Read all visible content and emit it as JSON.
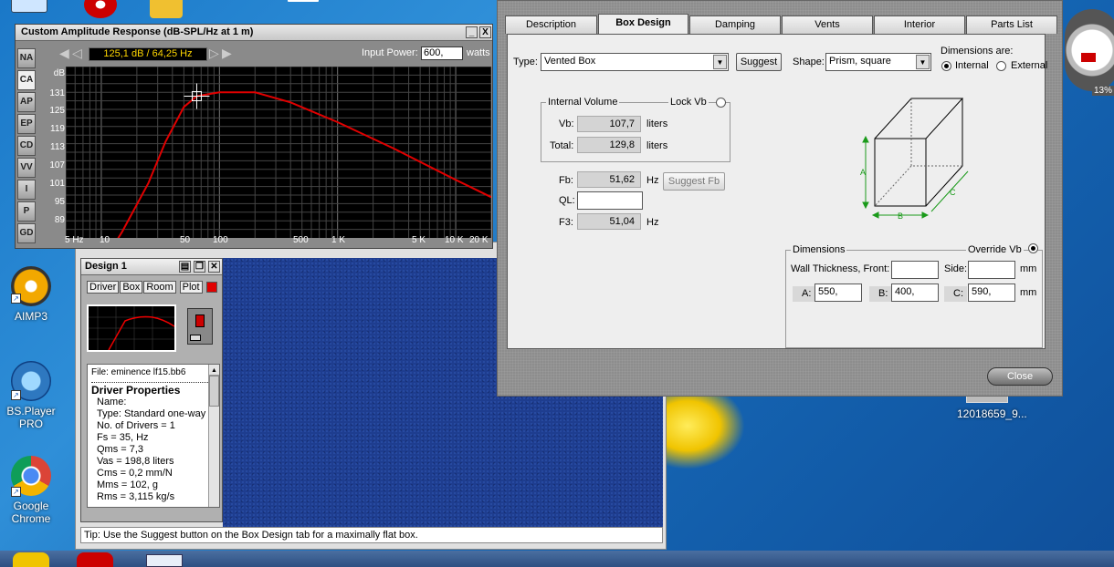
{
  "desktop": {
    "icons": [
      {
        "label": "AIMP3"
      },
      {
        "label": "BS.Player PRO"
      },
      {
        "label": "Google Chrome"
      },
      {
        "label": "12018659_9..."
      }
    ],
    "clock_widget": {
      "percent": "13%"
    }
  },
  "graph_window": {
    "title": "Custom Amplitude Response (dB-SPL/Hz at 1 m)",
    "readout": "125,1 dB / 64,25 Hz",
    "input_power_label": "Input Power:",
    "input_power_value": "600,",
    "input_power_unit": "watts",
    "side_tabs": [
      "NA",
      "CA",
      "AP",
      "EP",
      "CD",
      "VV",
      "I",
      "P",
      "GD"
    ],
    "y_unit": "dB",
    "y_ticks": [
      "131",
      "125",
      "119",
      "113",
      "107",
      "101",
      "95",
      "89"
    ],
    "x_ticks": [
      "5 Hz",
      "10",
      "50",
      "100",
      "500",
      "1 K",
      "5 K",
      "10 K",
      "20 K"
    ],
    "controls": {
      "minimize": "_",
      "close": "X"
    }
  },
  "design_window": {
    "title": "Design 1",
    "tabs": [
      "Driver",
      "Box",
      "Room",
      "Plot"
    ],
    "file": "File: eminence lf15.bb6",
    "props_title": "Driver Properties",
    "props": [
      "Name:",
      "Type: Standard one-way",
      "No. of Drivers = 1",
      "Fs = 35, Hz",
      "Qms = 7,3",
      "Vas = 198,8 liters",
      "Cms = 0,2 mm/N",
      "Mms = 102, g",
      "Rms = 3,115 kg/s"
    ]
  },
  "status": {
    "tip": "Tip: Use the Suggest button on the Box Design tab for a maximally flat box."
  },
  "dialog": {
    "tabs": [
      "Description",
      "Box Design",
      "Damping",
      "Vents",
      "Interior",
      "Parts List"
    ],
    "active_tab": "Box Design",
    "type_label": "Type:",
    "type_value": "Vented Box",
    "suggest": "Suggest",
    "shape_label": "Shape:",
    "shape_value": "Prism, square",
    "dims_are_label": "Dimensions are:",
    "internal": "Internal",
    "external": "External",
    "internal_volume_label": "Internal Volume",
    "lock_vb": "Lock Vb",
    "vb_label": "Vb:",
    "vb_value": "107,7",
    "liters1": "liters",
    "total_label": "Total:",
    "total_value": "129,8",
    "liters2": "liters",
    "fb_label": "Fb:",
    "fb_value": "51,62",
    "hz1": "Hz",
    "suggest_fb": "Suggest Fb",
    "ql_label": "QL:",
    "ql_value": "",
    "f3_label": "F3:",
    "f3_value": "51,04",
    "hz2": "Hz",
    "dimensions_label": "Dimensions",
    "override_vb": "Override Vb",
    "wall_label": "Wall Thickness, Front:",
    "wall_value": "",
    "side_label": "Side:",
    "side_value": "",
    "mm1": "mm",
    "a_label": "A:",
    "a_value": "550,",
    "b_label": "B:",
    "b_value": "400,",
    "c_label": "C:",
    "c_value": "590,",
    "mm2": "mm",
    "box_letters": {
      "a": "A",
      "b": "B",
      "c": "C"
    },
    "close": "Close"
  }
}
